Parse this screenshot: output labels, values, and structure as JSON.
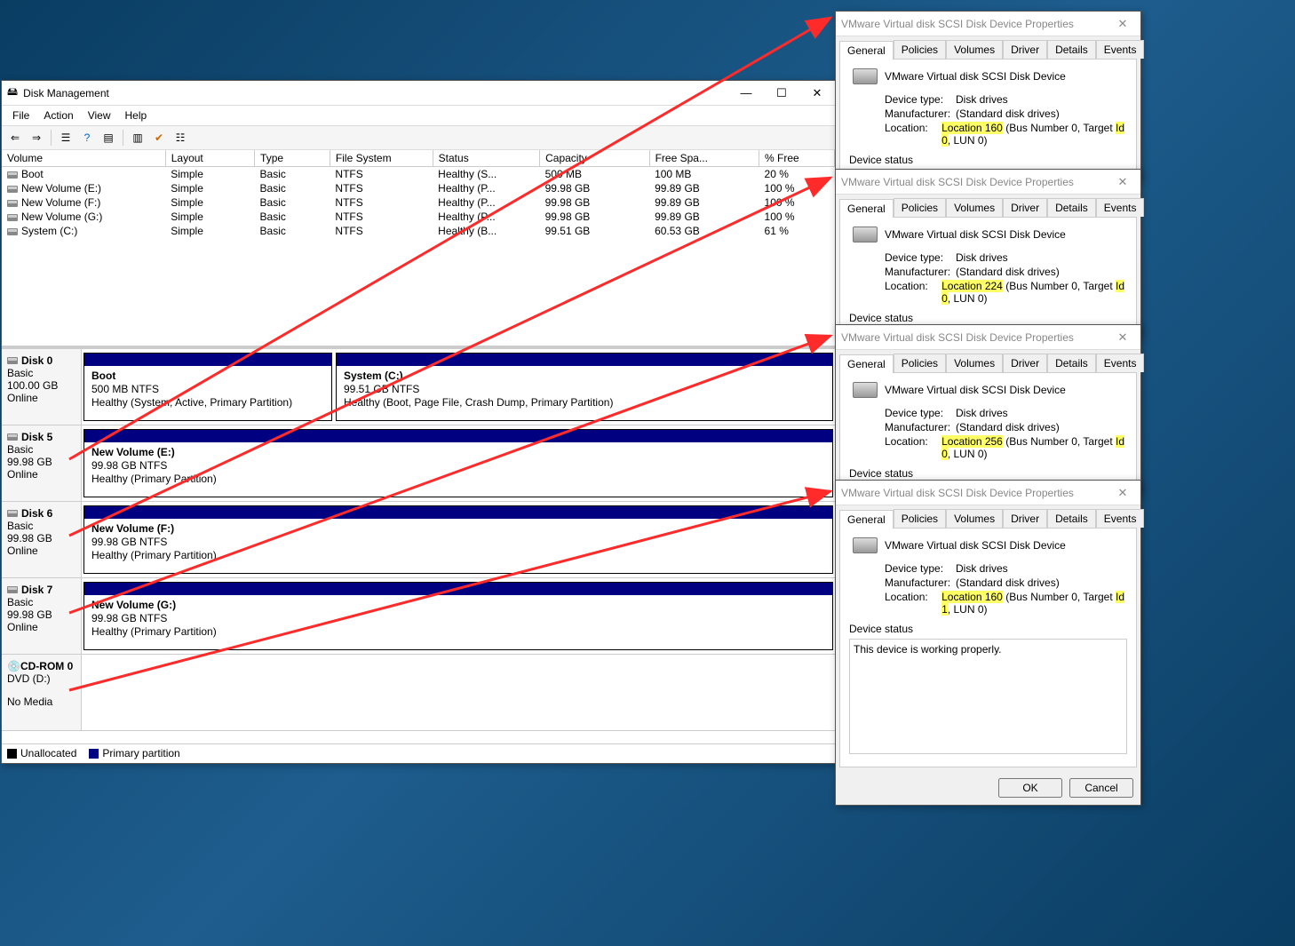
{
  "diskmgmt": {
    "title": "Disk Management",
    "menu": [
      "File",
      "Action",
      "View",
      "Help"
    ],
    "columns": [
      "Volume",
      "Layout",
      "Type",
      "File System",
      "Status",
      "Capacity",
      "Free Spa...",
      "% Free"
    ],
    "volumes": [
      {
        "name": "Boot",
        "layout": "Simple",
        "type": "Basic",
        "fs": "NTFS",
        "status": "Healthy (S...",
        "cap": "500 MB",
        "free": "100 MB",
        "pct": "20 %"
      },
      {
        "name": "New Volume (E:)",
        "layout": "Simple",
        "type": "Basic",
        "fs": "NTFS",
        "status": "Healthy (P...",
        "cap": "99.98 GB",
        "free": "99.89 GB",
        "pct": "100 %"
      },
      {
        "name": "New Volume (F:)",
        "layout": "Simple",
        "type": "Basic",
        "fs": "NTFS",
        "status": "Healthy (P...",
        "cap": "99.98 GB",
        "free": "99.89 GB",
        "pct": "100 %"
      },
      {
        "name": "New Volume (G:)",
        "layout": "Simple",
        "type": "Basic",
        "fs": "NTFS",
        "status": "Healthy (P...",
        "cap": "99.98 GB",
        "free": "99.89 GB",
        "pct": "100 %"
      },
      {
        "name": "System (C:)",
        "layout": "Simple",
        "type": "Basic",
        "fs": "NTFS",
        "status": "Healthy (B...",
        "cap": "99.51 GB",
        "free": "60.53 GB",
        "pct": "61 %"
      }
    ],
    "disks": [
      {
        "label": "Disk 0",
        "type": "Basic",
        "size": "100.00 GB",
        "state": "Online",
        "parts": [
          {
            "title": "Boot",
            "sub": "500 MB NTFS",
            "health": "Healthy (System, Active, Primary Partition)",
            "flex": "0 0 280px"
          },
          {
            "title": "System  (C:)",
            "sub": "99.51 GB NTFS",
            "health": "Healthy (Boot, Page File, Crash Dump, Primary Partition)",
            "flex": "1"
          }
        ]
      },
      {
        "label": "Disk 5",
        "type": "Basic",
        "size": "99.98 GB",
        "state": "Online",
        "parts": [
          {
            "title": "New Volume  (E:)",
            "sub": "99.98 GB NTFS",
            "health": "Healthy (Primary Partition)",
            "flex": "1"
          }
        ]
      },
      {
        "label": "Disk 6",
        "type": "Basic",
        "size": "99.98 GB",
        "state": "Online",
        "parts": [
          {
            "title": "New Volume  (F:)",
            "sub": "99.98 GB NTFS",
            "health": "Healthy (Primary Partition)",
            "flex": "1"
          }
        ]
      },
      {
        "label": "Disk 7",
        "type": "Basic",
        "size": "99.98 GB",
        "state": "Online",
        "parts": [
          {
            "title": "New Volume  (G:)",
            "sub": "99.98 GB NTFS",
            "health": "Healthy (Primary Partition)",
            "flex": "1"
          }
        ]
      },
      {
        "label": "CD-ROM 0",
        "type": "DVD (D:)",
        "size": "",
        "state": "No Media",
        "cd": true,
        "parts": []
      }
    ],
    "legend": {
      "unalloc": "Unallocated",
      "primary": "Primary partition"
    }
  },
  "props_title": "VMware Virtual disk SCSI Disk Device Properties",
  "tabs": [
    "General",
    "Policies",
    "Volumes",
    "Driver",
    "Details",
    "Events"
  ],
  "devname": "VMware Virtual disk SCSI Disk Device",
  "dtype_label": "Device type:",
  "dtype_val": "Disk drives",
  "manu_label": "Manufacturer:",
  "manu_val": "(Standard disk drives)",
  "loc_label": "Location:",
  "locs": [
    {
      "hi": "Location 160",
      "mid": " (Bus Number 0, Target ",
      "hi2": "Id 0",
      "tail": ", LUN 0)"
    },
    {
      "hi": "Location 224",
      "mid": " (Bus Number 0, Target ",
      "hi2": "Id 0",
      "tail": ", LUN 0)"
    },
    {
      "hi": "Location 256",
      "mid": " (Bus Number 0, Target ",
      "hi2": "Id 0",
      "tail": ", LUN 0)"
    },
    {
      "hi": "Location 160",
      "mid": " (Bus Number 0, Target ",
      "hi2": "Id 1",
      "tail": ", LUN 0)"
    }
  ],
  "devstatus_label": "Device status",
  "devstatus_text": "This device is working properly.",
  "ok": "OK",
  "cancel": "Cancel"
}
